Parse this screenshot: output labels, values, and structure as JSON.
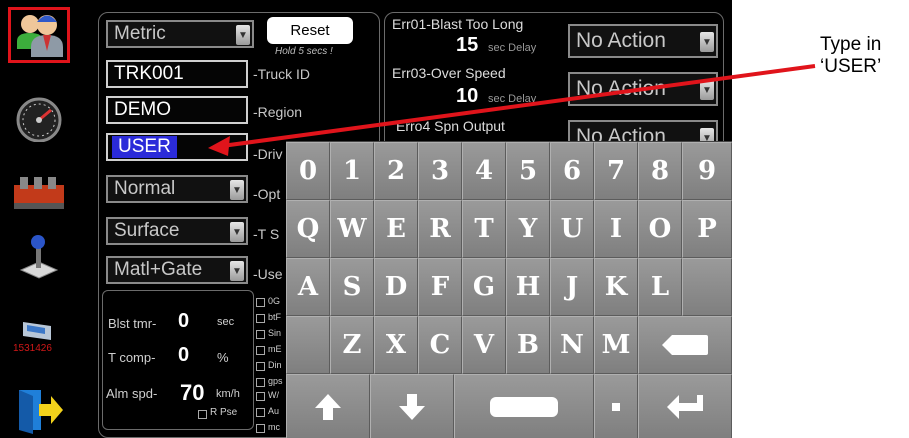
{
  "units": "Metric",
  "reset": {
    "label": "Reset",
    "hint": "Hold 5 secs !"
  },
  "truck_id": {
    "value": "TRK001",
    "label": "-Truck ID"
  },
  "region": {
    "value": "DEMO",
    "label": "-Region"
  },
  "driver": {
    "value": "USER",
    "label": "-Driv"
  },
  "mode": {
    "value": "Normal",
    "label": "-Opt"
  },
  "surface": {
    "value": "Surface",
    "label": "-T S"
  },
  "matl": {
    "value": "Matl+Gate",
    "label": "-Use"
  },
  "settings": [
    {
      "label": "Blst tmr-",
      "value": "0",
      "unit": "sec"
    },
    {
      "label": "T comp-",
      "value": "0",
      "unit": "%"
    },
    {
      "label": "Alm spd-",
      "value": "70",
      "unit": "km/h"
    }
  ],
  "r_pse_label": "R Pse",
  "check_labels": [
    "0G",
    "btF",
    "Sin",
    "mE",
    "Din",
    "gps",
    "W/",
    "Au",
    "mc"
  ],
  "errors": {
    "e1": {
      "label": "Err01-Blast Too Long",
      "value": "15",
      "unit": "sec Delay",
      "action": "No Action"
    },
    "e3": {
      "label": "Err03-Over Speed",
      "value": "10",
      "unit": "sec Delay",
      "action": "No Action"
    },
    "e4": {
      "label": "Erro4 Spn Output",
      "action": "No Action"
    }
  },
  "keyboard": {
    "row1": [
      "0",
      "1",
      "2",
      "3",
      "4",
      "5",
      "6",
      "7",
      "8",
      "9"
    ],
    "row2": [
      "Q",
      "W",
      "E",
      "R",
      "T",
      "Y",
      "U",
      "I",
      "O",
      "P"
    ],
    "row3": [
      "A",
      "S",
      "D",
      "F",
      "G",
      "H",
      "J",
      "K",
      "L"
    ],
    "row4": [
      "Z",
      "X",
      "C",
      "V",
      "B",
      "N",
      "M"
    ]
  },
  "icons": [
    "user-icon",
    "speedometer-icon",
    "valve-icon",
    "joystick-icon",
    "truck-id-icon",
    "exit-door-icon"
  ],
  "truck_icon_number": "1531426",
  "annotation": {
    "line1": "Type in",
    "line2": "‘USER’"
  },
  "colors": {
    "selected_border": "#e0141b",
    "highlight": "#2b2bd9",
    "arrow": "#e0141b"
  }
}
